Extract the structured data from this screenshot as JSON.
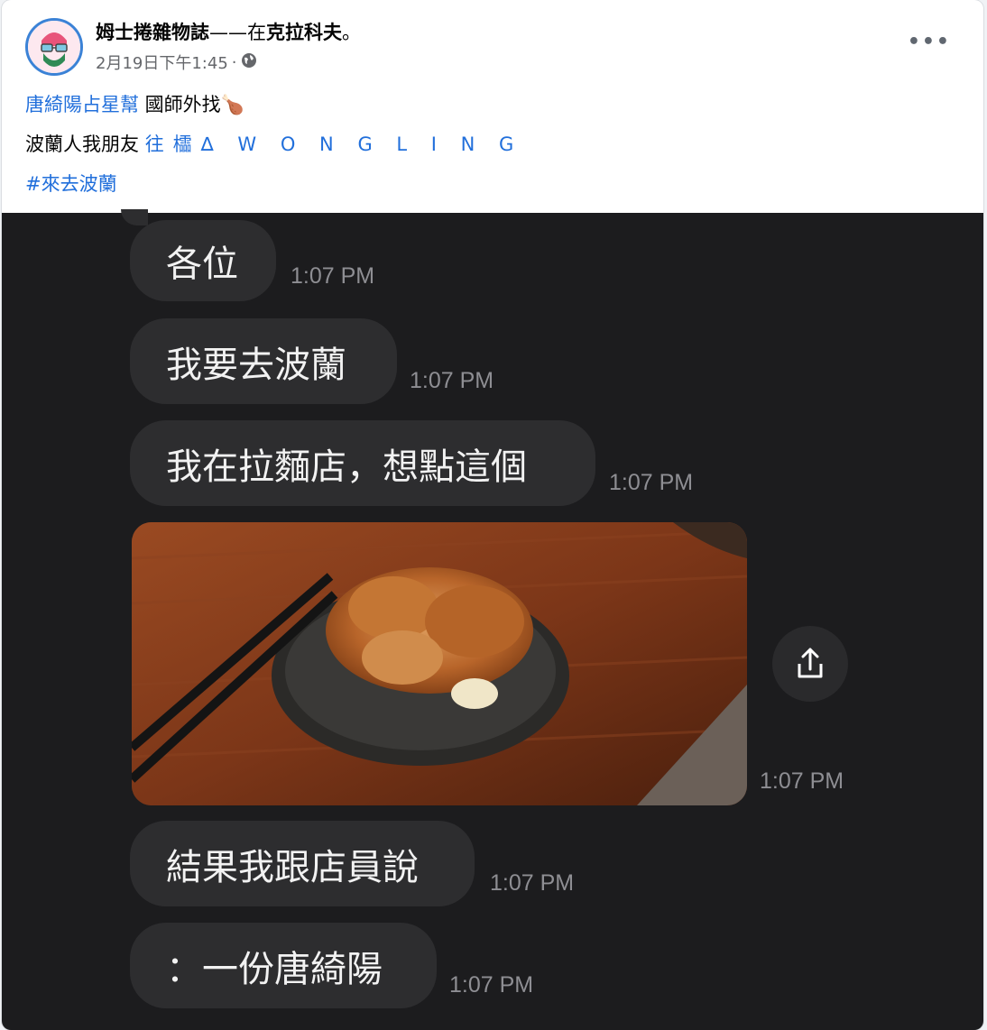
{
  "post": {
    "author": "姆士捲雜物誌",
    "feeling_text": "——在",
    "location": "克拉科夫",
    "location_suffix": "。",
    "date": "2月19日下午1:45",
    "separator": "·",
    "privacy_icon": "globe-icon",
    "more_icon": "more-options-icon",
    "more_text": "•••",
    "line1_tag": "唐綺陽占星幫",
    "line1_text": " 國師外找",
    "line1_emoji": "🍗",
    "line2_text": "波蘭人我朋友 ",
    "line2_tag": "往櫺∆ W O N G L I N G",
    "hashtag": "#來去波蘭"
  },
  "chat": {
    "messages": [
      {
        "text": "各位",
        "time": "1:07 PM"
      },
      {
        "text": "我要去波蘭",
        "time": "1:07 PM"
      },
      {
        "text": "我在拉麵店，想點這個",
        "time": "1:07 PM"
      },
      {
        "text": "",
        "time": "1:07 PM"
      },
      {
        "text": "結果我跟店員說",
        "time": "1:07 PM"
      },
      {
        "text": "：一份唐綺陽",
        "time": "1:07 PM"
      }
    ],
    "photo_description": "fried-chicken-photo",
    "share_icon": "share-icon"
  },
  "colors": {
    "link": "#216fdb",
    "chat_bg": "#1c1c1e",
    "bubble_bg": "#2d2d2f"
  }
}
